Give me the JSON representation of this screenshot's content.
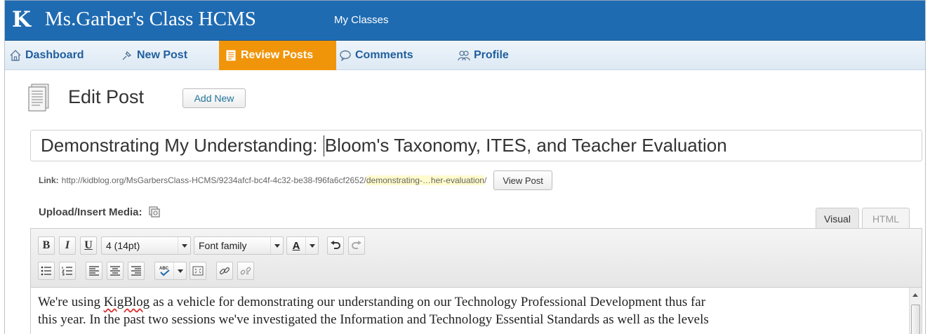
{
  "header": {
    "logo": "K",
    "site_title": "Ms.Garber's Class HCMS",
    "my_classes": "My Classes"
  },
  "nav": {
    "items": [
      {
        "label": "Dashboard",
        "icon": "home-icon"
      },
      {
        "label": "New Post",
        "icon": "pin-icon"
      },
      {
        "label": "Review Posts",
        "icon": "document-icon",
        "active": true
      },
      {
        "label": "Comments",
        "icon": "comment-icon"
      },
      {
        "label": "Profile",
        "icon": "users-icon"
      }
    ],
    "active_color": "#f0950a"
  },
  "edit": {
    "title": "Edit Post",
    "add_new": "Add New"
  },
  "post": {
    "title_before_caret": "Demonstrating My Understanding: ",
    "title_after_caret": "Bloom's Taxonomy, ITES, and Teacher Evaluation",
    "link_label": "Link:",
    "link_base": "http://kidblog.org/MsGarbersClass-HCMS/9234afcf-bc4f-4c32-be38-f96fa6cf2652/",
    "link_slug": "demonstrating-…her-evaluation",
    "link_tail": "/",
    "view_post": "View Post"
  },
  "media": {
    "label": "Upload/Insert Media:"
  },
  "tabs": {
    "visual": "Visual",
    "html": "HTML"
  },
  "toolbar": {
    "bold": "B",
    "italic": "I",
    "underline": "U",
    "font_size": "4 (14pt)",
    "font_family": "Font family",
    "text_color": "A"
  },
  "content": {
    "line1_pre": "We're using ",
    "line1_misspelled": "KigBlog",
    "line1_post": " as a vehicle for demonstrating our understanding on our Technology Professional Development thus far",
    "line2": "this year. In the past two sessions we've investigated the Information and Technology Essential Standards as well as the levels"
  }
}
